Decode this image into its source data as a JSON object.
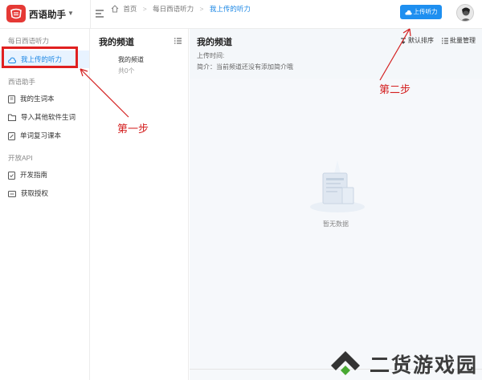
{
  "app": {
    "title": "西语助手"
  },
  "breadcrumb": {
    "home": "首页",
    "section": "每日西语听力",
    "current": "我上传的听力"
  },
  "toolbar": {
    "upload_label": "上传听力"
  },
  "sidebar": {
    "section1": "每日西语听力",
    "item_my_uploads": "我上传的听力",
    "section2": "西语助手",
    "item_vocab": "我的生词本",
    "item_import": "导入其他软件生词",
    "item_review": "单词复习课本",
    "section3": "开放API",
    "item_guide": "开发指南",
    "item_auth": "获取授权"
  },
  "channels": {
    "title": "我的频道",
    "item_name": "我的频道",
    "item_count": "共0个"
  },
  "main": {
    "title": "我的频道",
    "upload_time": "上传时间:",
    "intro": "简介：当前频道还没有添加简介哦",
    "sort_label": "默认排序",
    "batch_label": "批量管理",
    "empty_text": "暂无数据"
  },
  "annotations": {
    "step1": "第一步",
    "step2": "第二步",
    "color": "#d42020"
  },
  "watermark": {
    "text": "二货游戏园"
  },
  "colors": {
    "accent": "#1e88e5",
    "brand": "#e53935",
    "highlight": "#e02020"
  }
}
